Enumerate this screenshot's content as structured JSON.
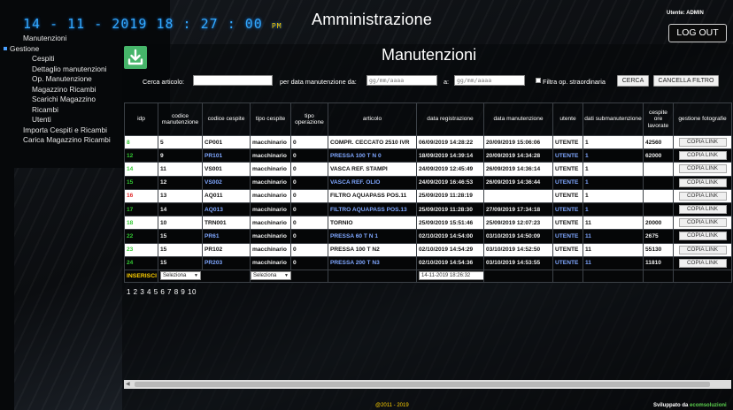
{
  "clock": {
    "time": "14 - 11 - 2019 18 : 27 : 00",
    "suffix": "PM"
  },
  "app": {
    "title": "Amministrazione",
    "user_label": "Utente: ADMIN",
    "logout_label": "LOG OUT"
  },
  "sidebar": {
    "items": [
      {
        "label": "Manutenzioni"
      },
      {
        "label": "Gestione"
      },
      {
        "label": "Cespiti"
      },
      {
        "label": "Dettaglio manutenzioni"
      },
      {
        "label": "Op. Manutenzione"
      },
      {
        "label": "Magazzino Ricambi"
      },
      {
        "label": "Scarichi Magazzino"
      },
      {
        "label": "Ricambi"
      },
      {
        "label": "Utenti"
      },
      {
        "label": "Importa Cespiti e Ricambi"
      },
      {
        "label": "Carica Magazzino Ricambi"
      }
    ]
  },
  "page": {
    "title": "Manutenzioni"
  },
  "filters": {
    "search_label": "Cerca articolo:",
    "search_value": "",
    "date_from_label": "per data manutenzione da:",
    "date_from_placeholder": "gg/mm/aaaa",
    "date_to_label": "a:",
    "date_to_placeholder": "gg/mm/aaaa",
    "extraordinary_label": "Filtra op. straordinaria",
    "search_button": "CERCA",
    "clear_button": "CANCELLA FILTRO"
  },
  "table": {
    "headers": [
      "idp",
      "codice manutenzione",
      "codice cespite",
      "tipo cespite",
      "tipo operazione",
      "articolo",
      "data registrazione",
      "data manutenzione",
      "utente",
      "dati submanutenzione",
      "cespite ore lavorate",
      "gestione fotografie"
    ],
    "rows": [
      {
        "idp": "8",
        "codice": "5",
        "cespite": "CP001",
        "tipo": "macchinario",
        "op": "0",
        "articolo": "COMPR. CECCATO 2510 IVR",
        "reg": "06/09/2019 14:28:22",
        "man": "20/09/2019 15:06:06",
        "utente": "UTENTE",
        "sub": "1",
        "ore": "42560",
        "btn": "COPIA LINK"
      },
      {
        "idp": "12",
        "codice": "9",
        "cespite": "PR101",
        "tipo": "macchinario",
        "op": "0",
        "articolo": "PRESSA 100 T N 0",
        "reg": "18/09/2019 14:39:14",
        "man": "20/09/2019 14:34:28",
        "utente": "UTENTE",
        "sub": "1",
        "ore": "62000",
        "btn": "COPIA LINK"
      },
      {
        "idp": "14",
        "codice": "11",
        "cespite": "VS001",
        "tipo": "macchinario",
        "op": "0",
        "articolo": "VASCA REF. STAMPI",
        "reg": "24/09/2019 12:45:49",
        "man": "26/09/2019 14:36:14",
        "utente": "UTENTE",
        "sub": "1",
        "ore": "",
        "btn": "COPIA LINK"
      },
      {
        "idp": "15",
        "codice": "12",
        "cespite": "VS002",
        "tipo": "macchinario",
        "op": "0",
        "articolo": "VASCA REF. OLIO",
        "reg": "24/09/2019 16:46:53",
        "man": "26/09/2019 14:36:44",
        "utente": "UTENTE",
        "sub": "1",
        "ore": "",
        "btn": "COPIA LINK"
      },
      {
        "idp": "16",
        "codice": "13",
        "cespite": "AQ011",
        "tipo": "macchinario",
        "op": "0",
        "articolo": "FILTRO AQUAPASS POS.11",
        "reg": "25/09/2019 11:28:19",
        "man": "",
        "utente": "UTENTE",
        "sub": "1",
        "ore": "",
        "btn": "COPIA LINK"
      },
      {
        "idp": "17",
        "codice": "14",
        "cespite": "AQ013",
        "tipo": "macchinario",
        "op": "0",
        "articolo": "FILTRO AQUAPASS POS.13",
        "reg": "25/09/2019 11:28:30",
        "man": "27/09/2019 17:34:18",
        "utente": "UTENTE",
        "sub": "1",
        "ore": "",
        "btn": "COPIA LINK"
      },
      {
        "idp": "18",
        "codice": "10",
        "cespite": "TRN001",
        "tipo": "macchinario",
        "op": "0",
        "articolo": "TORNIO",
        "reg": "25/09/2019 15:51:46",
        "man": "25/09/2019 12:07:23",
        "utente": "UTENTE",
        "sub": "11",
        "ore": "20000",
        "btn": "COPIA LINK"
      },
      {
        "idp": "22",
        "codice": "15",
        "cespite": "PR61",
        "tipo": "macchinario",
        "op": "0",
        "articolo": "PRESSA 60 T N 1",
        "reg": "02/10/2019 14:54:00",
        "man": "03/10/2019 14:50:09",
        "utente": "UTENTE",
        "sub": "11",
        "ore": "2675",
        "btn": "COPIA LINK"
      },
      {
        "idp": "23",
        "codice": "15",
        "cespite": "PR102",
        "tipo": "macchinario",
        "op": "0",
        "articolo": "PRESSA 100 T N2",
        "reg": "02/10/2019 14:54:29",
        "man": "03/10/2019 14:52:50",
        "utente": "UTENTE",
        "sub": "11",
        "ore": "55130",
        "btn": "COPIA LINK"
      },
      {
        "idp": "24",
        "codice": "15",
        "cespite": "PR203",
        "tipo": "macchinario",
        "op": "0",
        "articolo": "PRESSA 200 T N3",
        "reg": "02/10/2019 14:54:36",
        "man": "03/10/2019 14:53:55",
        "utente": "UTENTE",
        "sub": "11",
        "ore": "11810",
        "btn": "COPIA LINK"
      }
    ],
    "insert_label": "INSERISCI",
    "select_label": "Seleziona",
    "insert_date": "14-11-2019 18:26:32"
  },
  "pager": {
    "pages": "1 2 3 4 5 6 7 8 9 10"
  },
  "footer": {
    "copyright": "@2011 - 2019",
    "right_prefix": "Sviluppato da",
    "right_highlight": "ecomsoluzioni"
  },
  "colors": {
    "id_green": "#32c732",
    "id_red": "#e0282a",
    "accent_yellow": "#ffd000",
    "clock_blue": "#33a9ff",
    "icon_green": "#46b56a"
  }
}
